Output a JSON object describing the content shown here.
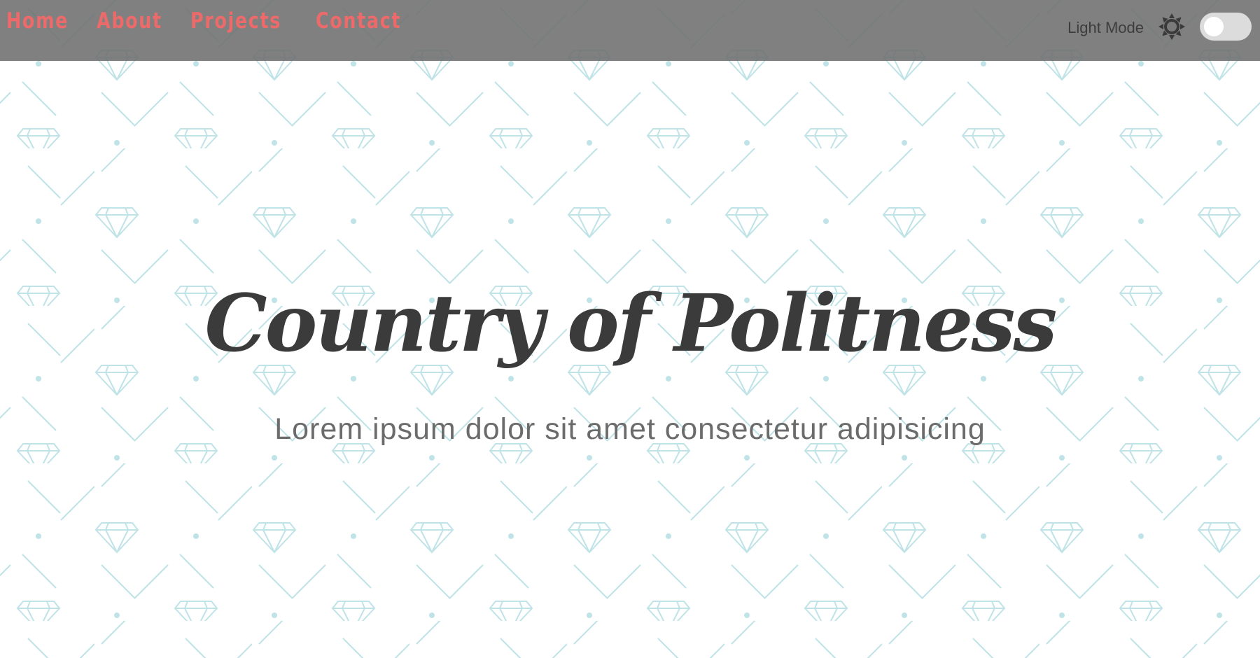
{
  "nav": {
    "links": [
      "Home",
      "About",
      "Projects",
      "Contact"
    ],
    "mode_label": "Light Mode",
    "mode_icon": "sun-icon",
    "toggle_on": false
  },
  "hero": {
    "title": "Country of Politness",
    "subtitle": "Lorem ipsum dolor sit amet consectetur adipisicing"
  },
  "colors": {
    "navbar_bg": "#6e6e6e",
    "nav_link": "#ec6a6a",
    "pattern": "#bfe3e7",
    "title": "#3b3b3b",
    "subtitle": "#6b6b6b"
  }
}
